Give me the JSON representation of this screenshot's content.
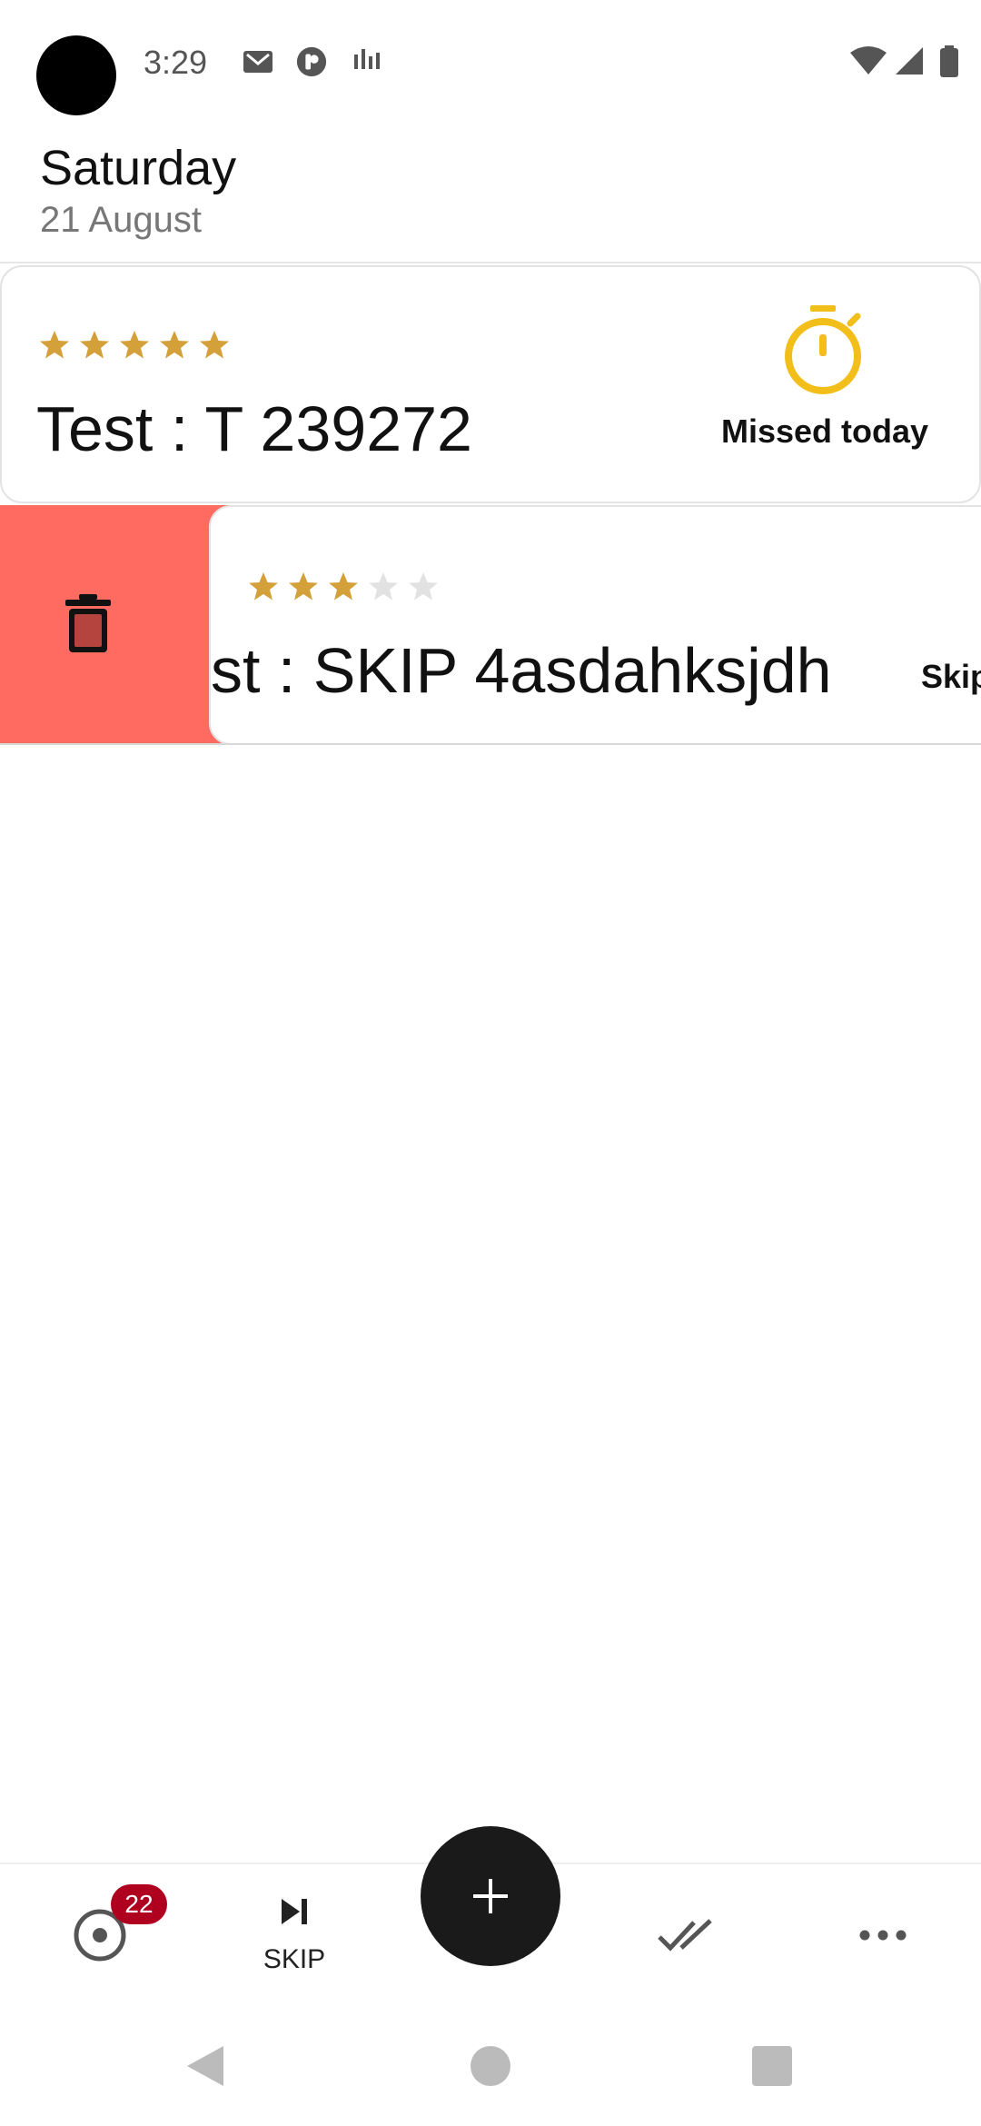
{
  "status_bar": {
    "time": "3:29",
    "left_icons": [
      "gmail-icon",
      "p-icon",
      "audio-bars-icon"
    ],
    "right_icons": [
      "wifi-icon",
      "signal-icon",
      "battery-icon"
    ]
  },
  "header": {
    "day": "Saturday",
    "date": "21 August"
  },
  "habits": [
    {
      "name": "Test : T 239272",
      "rating": 5,
      "rating_max": 5,
      "status": "Missed today",
      "status_icon": "stopwatch-icon"
    },
    {
      "name": "st : SKIP 4asdahksjdh",
      "rating": 3,
      "rating_max": 5,
      "status": "Skip",
      "swipe_action_icon": "trash-icon"
    }
  ],
  "bottom_nav": {
    "today_badge": "22",
    "skip_label": "SKIP",
    "fab_icon": "plus-icon",
    "done_icon": "double-check-icon",
    "more_icon": "more-horizontal-icon"
  },
  "colors": {
    "star_filled": "#d4a03a",
    "star_empty": "#e2e2e2",
    "timer": "#f2bf1a",
    "swipe_delete": "#ff6b61",
    "badge": "#b00020",
    "fab": "#1a1a1a"
  }
}
